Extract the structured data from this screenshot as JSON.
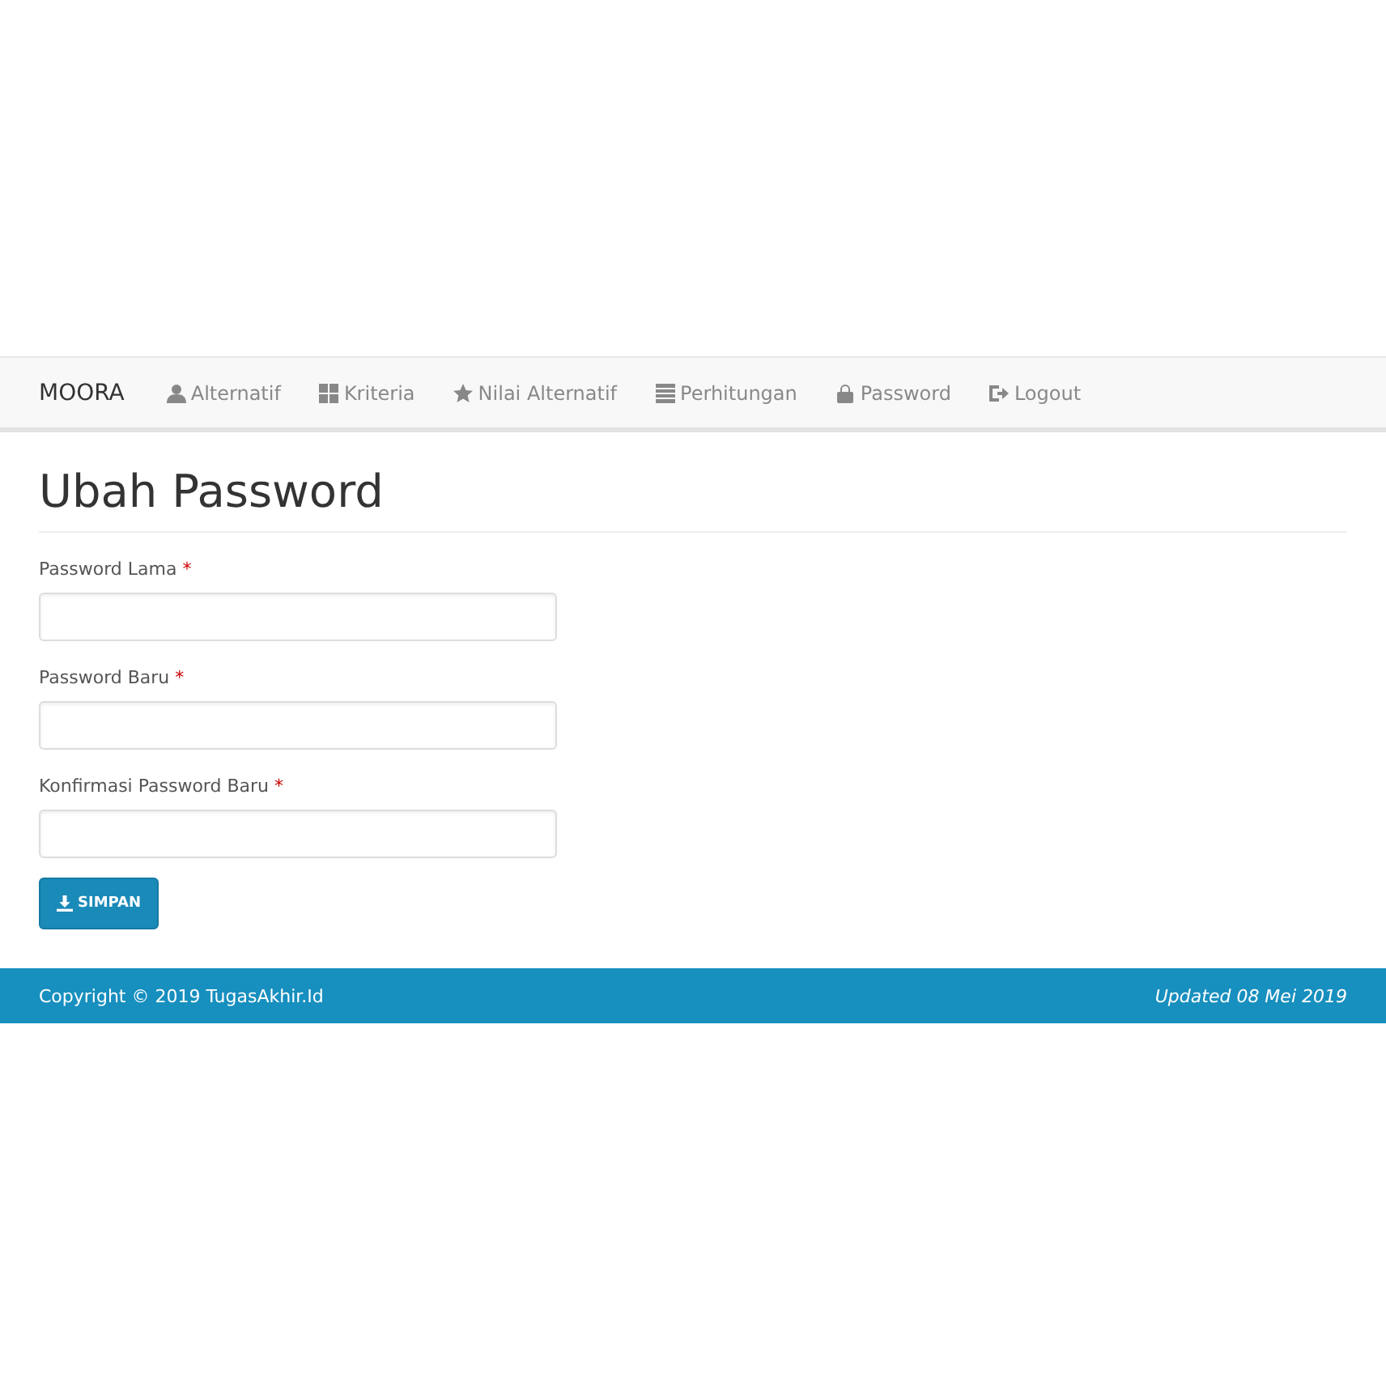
{
  "navbar": {
    "brand": "MOORA",
    "items": [
      {
        "label": "Alternatif"
      },
      {
        "label": "Kriteria"
      },
      {
        "label": "Nilai Alternatif"
      },
      {
        "label": "Perhitungan"
      },
      {
        "label": "Password"
      },
      {
        "label": "Logout"
      }
    ]
  },
  "page_title": "Ubah Password",
  "form": {
    "fields": [
      {
        "label": "Password Lama",
        "required_mark": "*"
      },
      {
        "label": "Password Baru",
        "required_mark": "*"
      },
      {
        "label": "Konfirmasi Password Baru",
        "required_mark": "*"
      }
    ],
    "submit": "SIMPAN"
  },
  "footer": {
    "copyright": "Copyright © 2019 TugasAkhir.Id",
    "updated": "Updated 08 Mei 2019"
  }
}
